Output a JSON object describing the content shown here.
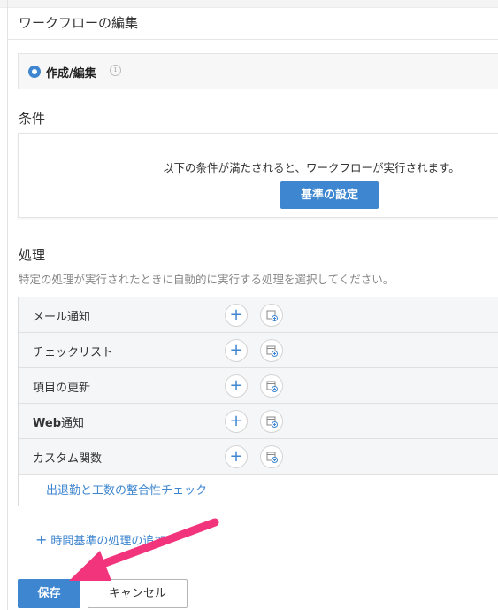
{
  "page": {
    "title": "ワークフローの編集"
  },
  "trigger": {
    "label": "作成/編集",
    "info_icon": "info-icon"
  },
  "conditions": {
    "heading": "条件",
    "description": "以下の条件が満たされると、ワークフローが実行されます。",
    "button_label": "基準の設定"
  },
  "actions": {
    "heading": "処理",
    "description": "特定の処理が実行されたときに自動的に実行する処理を選択してください。",
    "rows": [
      {
        "label": "メール通知"
      },
      {
        "label": "チェックリスト"
      },
      {
        "label": "項目の更新"
      },
      {
        "label_bold": "Web",
        "label_rest": "通知"
      },
      {
        "label": "カスタム関数"
      }
    ],
    "consistency_link": "出退勤と工数の整合性チェック",
    "add_time_based": "時間基準の処理の追加",
    "plus_icon": "plus-icon",
    "associate_icon": "associate-icon"
  },
  "footer": {
    "save_label": "保存",
    "cancel_label": "キャンセル"
  },
  "colors": {
    "accent": "#3e86cf",
    "annotation_arrow": "#f2347c"
  }
}
